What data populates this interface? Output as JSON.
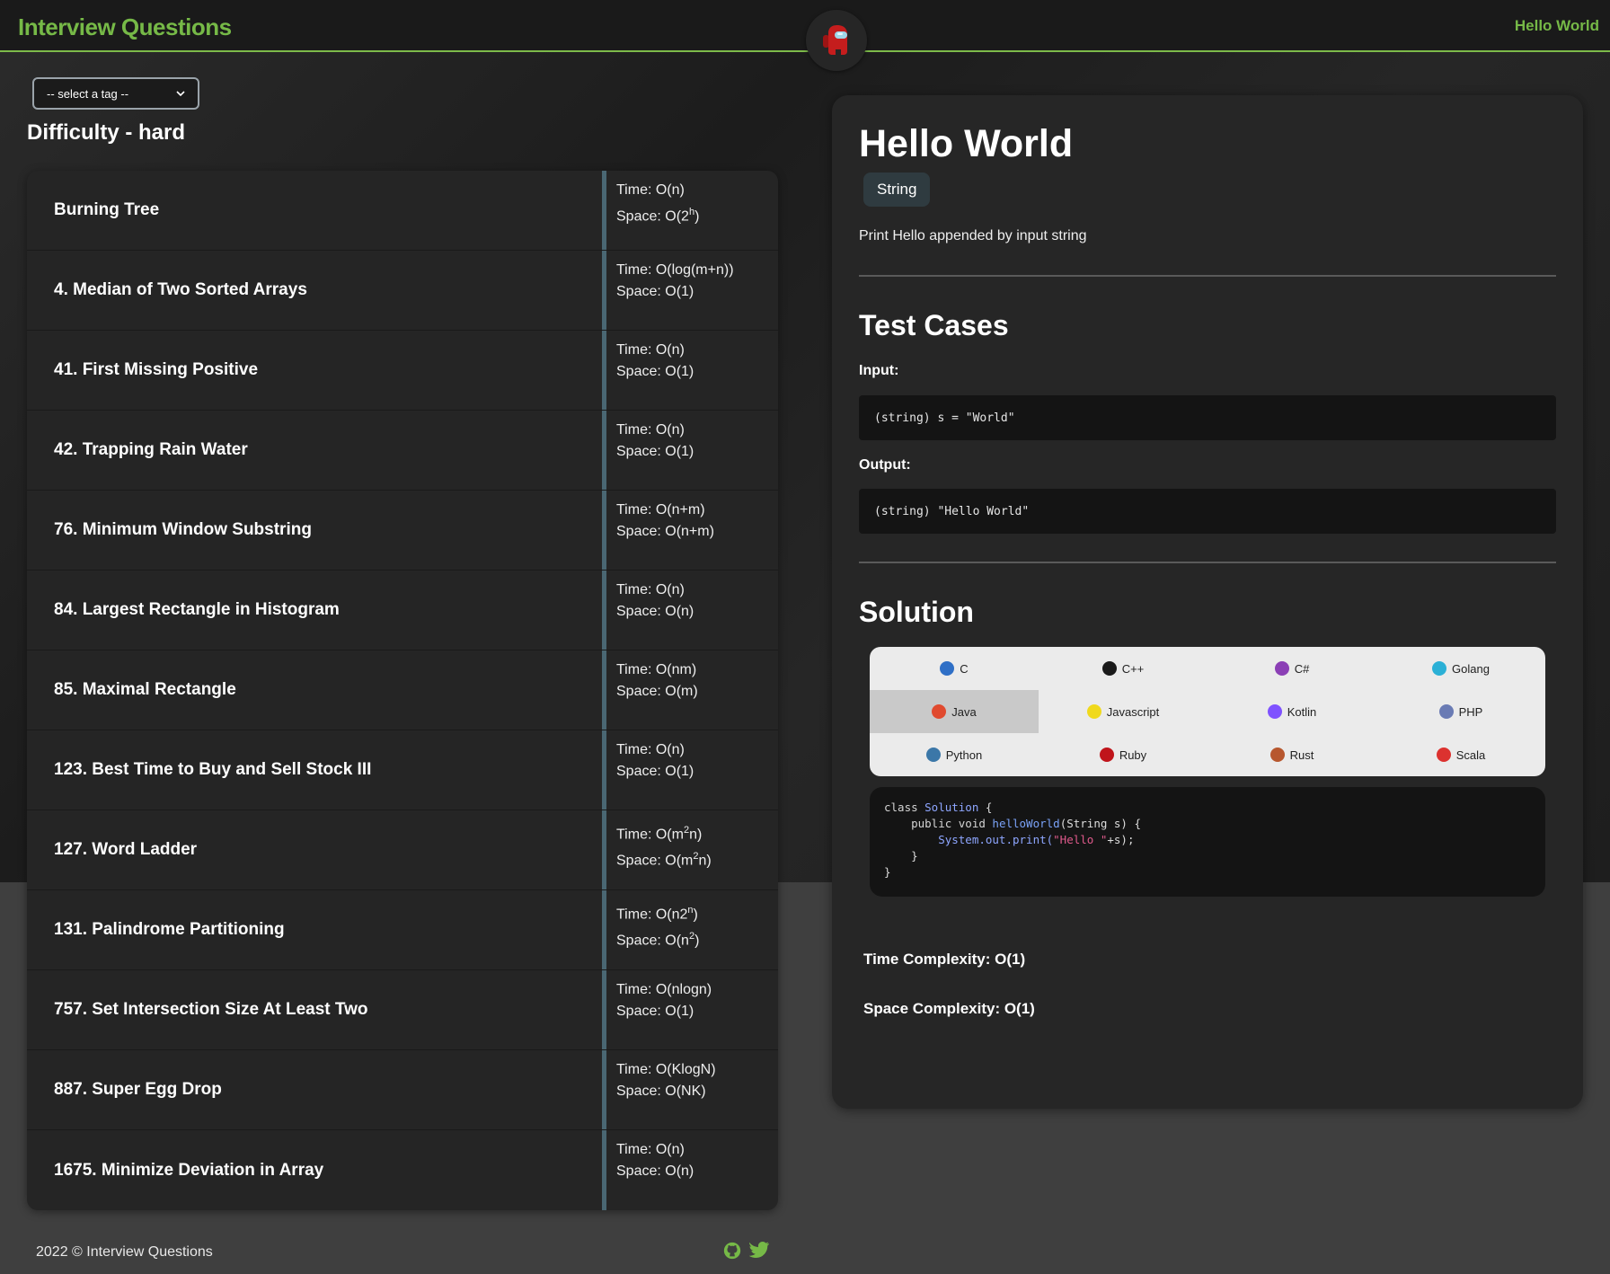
{
  "header": {
    "brand": "Interview Questions",
    "nav_right": "Hello World"
  },
  "filter": {
    "select_value": "-- select a tag --",
    "difficulty_heading": "Difficulty - hard"
  },
  "questions": [
    {
      "title": "Burning Tree",
      "time": "Time: O(n)",
      "space": "Space: O(2",
      "space_sup": "h",
      "space_tail": ")"
    },
    {
      "title": "4. Median of Two Sorted Arrays",
      "time": "Time: O(log(m+n))",
      "space": "Space: O(1)"
    },
    {
      "title": "41. First Missing Positive",
      "time": "Time: O(n)",
      "space": "Space: O(1)"
    },
    {
      "title": "42. Trapping Rain Water",
      "time": "Time: O(n)",
      "space": "Space: O(1)"
    },
    {
      "title": "76. Minimum Window Substring",
      "time": "Time: O(n+m)",
      "space": "Space: O(n+m)"
    },
    {
      "title": "84. Largest Rectangle in Histogram",
      "time": "Time: O(n)",
      "space": "Space: O(n)"
    },
    {
      "title": "85. Maximal Rectangle",
      "time": "Time: O(nm)",
      "space": "Space: O(m)"
    },
    {
      "title": "123. Best Time to Buy and Sell Stock III",
      "time": "Time: O(n)",
      "space": "Space: O(1)"
    },
    {
      "title": "127. Word Ladder",
      "time": "Time: O(m",
      "time_sup": "2",
      "time_tail": "n)",
      "space": "Space: O(m",
      "space_sup": "2",
      "space_tail": "n)"
    },
    {
      "title": "131. Palindrome Partitioning",
      "time": "Time: O(n2",
      "time_sup": "n",
      "time_tail": ")",
      "space": "Space: O(n",
      "space_sup": "2",
      "space_tail": ")"
    },
    {
      "title": "757. Set Intersection Size At Least Two",
      "time": "Time: O(nlogn)",
      "space": "Space: O(1)"
    },
    {
      "title": "887. Super Egg Drop",
      "time": "Time: O(KlogN)",
      "space": "Space: O(NK)"
    },
    {
      "title": "1675. Minimize Deviation in Array",
      "time": "Time: O(n)",
      "space": "Space: O(n)"
    }
  ],
  "footer": {
    "copyright": "2022 © Interview Questions",
    "icons": [
      "github-icon",
      "twitter-icon"
    ]
  },
  "detail": {
    "title": "Hello World",
    "tag": "String",
    "description": "Print Hello appended by input string",
    "test_cases_heading": "Test Cases",
    "input_label": "Input:",
    "input_value": "(string) s = \"World\"",
    "output_label": "Output:",
    "output_value": "(string) \"Hello World\"",
    "solution_heading": "Solution",
    "languages": [
      {
        "name": "C",
        "icon": "c-icon",
        "color": "#2f6fc6"
      },
      {
        "name": "C++",
        "icon": "cpp-icon",
        "color": "#1a1a1a"
      },
      {
        "name": "C#",
        "icon": "csharp-icon",
        "color": "#8b3fb5"
      },
      {
        "name": "Golang",
        "icon": "golang-icon",
        "color": "#2bb0d6"
      },
      {
        "name": "Java",
        "icon": "java-icon",
        "color": "#e04a2f",
        "active": true
      },
      {
        "name": "Javascript",
        "icon": "javascript-icon",
        "color": "#f0d91c"
      },
      {
        "name": "Kotlin",
        "icon": "kotlin-icon",
        "color": "#7f52ff"
      },
      {
        "name": "PHP",
        "icon": "php-icon",
        "color": "#6a7bb4"
      },
      {
        "name": "Python",
        "icon": "python-icon",
        "color": "#3b77a8"
      },
      {
        "name": "Ruby",
        "icon": "ruby-icon",
        "color": "#c0151b"
      },
      {
        "name": "Rust",
        "icon": "rust-icon",
        "color": "#b7572e"
      },
      {
        "name": "Scala",
        "icon": "scala-icon",
        "color": "#dc322f"
      }
    ],
    "code": {
      "line1_kw": "class ",
      "line1_cls": "Solution",
      "line1_tail": " {",
      "line2_kw": "    public void ",
      "line2_fn": "helloWorld",
      "line2_tail": "(String s) {",
      "line3_cls": "        System",
      "line3_mid": ".out.print(",
      "line3_str": "\"Hello \"",
      "line3_tail": "+s);",
      "line4": "    }",
      "line5": "}"
    },
    "time_complexity": "Time Complexity: O(1)",
    "space_complexity": "Space Complexity: O(1)"
  }
}
